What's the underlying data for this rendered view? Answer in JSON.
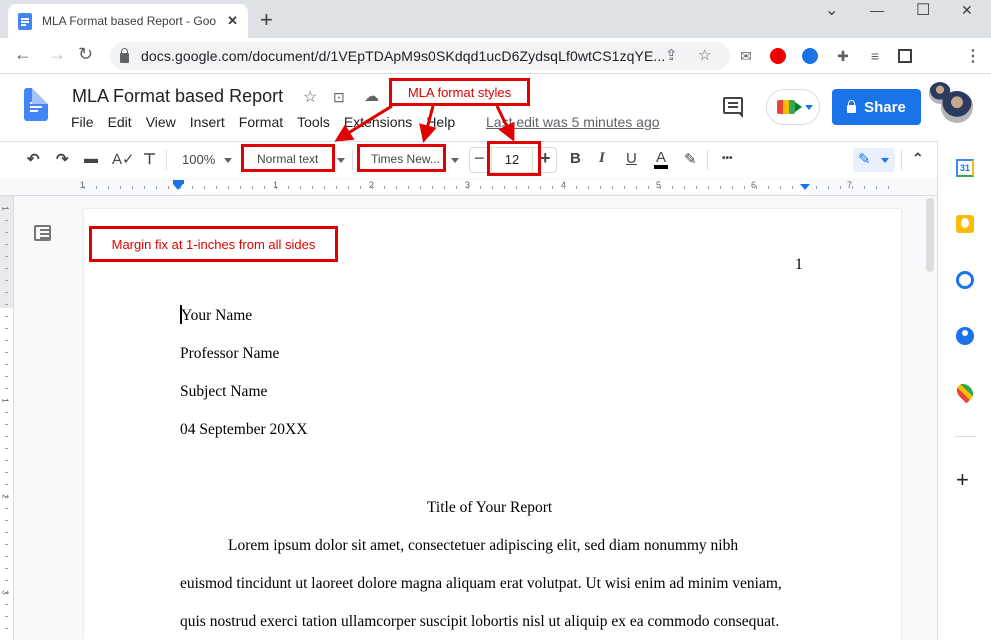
{
  "browser": {
    "tab_title": "MLA Format based Report - Goo",
    "tab_close": "✕",
    "new_tab": "+",
    "window_controls": {
      "dropdown": "⌄",
      "minimize": "—",
      "maximize": "☐",
      "close": "✕"
    },
    "nav": {
      "back": "←",
      "forward": "→",
      "reload": "↻"
    },
    "url": "docs.google.com/document/d/1VEpTDApM9s0SKdqd1ucD6ZydsqLf0wtCS1zqYE...",
    "extensions": [
      "mail-extension",
      "adblock-extension",
      "blue-extension",
      "puzzle-extensions",
      "media-control",
      "side-panel-toggle",
      "profile-avatar",
      "more-menu"
    ]
  },
  "docs": {
    "title": "MLA Format based Report",
    "menu": [
      "File",
      "Edit",
      "View",
      "Insert",
      "Format",
      "Tools",
      "Extensions",
      "Help"
    ],
    "last_edit": "Last edit was 5 minutes ago",
    "share_label": "Share"
  },
  "toolbar": {
    "zoom": "100%",
    "style": "Normal text",
    "font": "Times New...",
    "font_size": "12",
    "minus": "−",
    "plus": "+",
    "bold": "B",
    "italic": "I",
    "underline": "U",
    "text_color": "A",
    "more": "•••"
  },
  "ruler": {
    "h_labels": [
      "1",
      "1",
      "2",
      "3",
      "4",
      "5",
      "6",
      "7"
    ],
    "v_labels": [
      "1",
      "1",
      "2",
      "3"
    ]
  },
  "document": {
    "page_number": "1",
    "header_lines": [
      "Your Name",
      "Professor Name",
      "Subject Name",
      "04 September 20XX"
    ],
    "report_title": "Title of Your Report",
    "body_lines": [
      "Lorem ipsum dolor sit amet, consectetuer adipiscing elit, sed diam nonummy nibh",
      "euismod tincidunt ut laoreet dolore magna aliquam erat volutpat. Ut wisi enim ad minim veniam,",
      "quis nostrud exerci tation ullamcorper suscipit lobortis nisl ut aliquip ex ea commodo consequat."
    ]
  },
  "annotations": {
    "styles_label": "MLA format styles",
    "margin_label": "Margin fix at 1-inches from all sides",
    "color": "#e00000"
  },
  "side_panel": [
    "calendar",
    "keep",
    "tasks",
    "contacts",
    "maps"
  ],
  "side_panel_add": "+"
}
